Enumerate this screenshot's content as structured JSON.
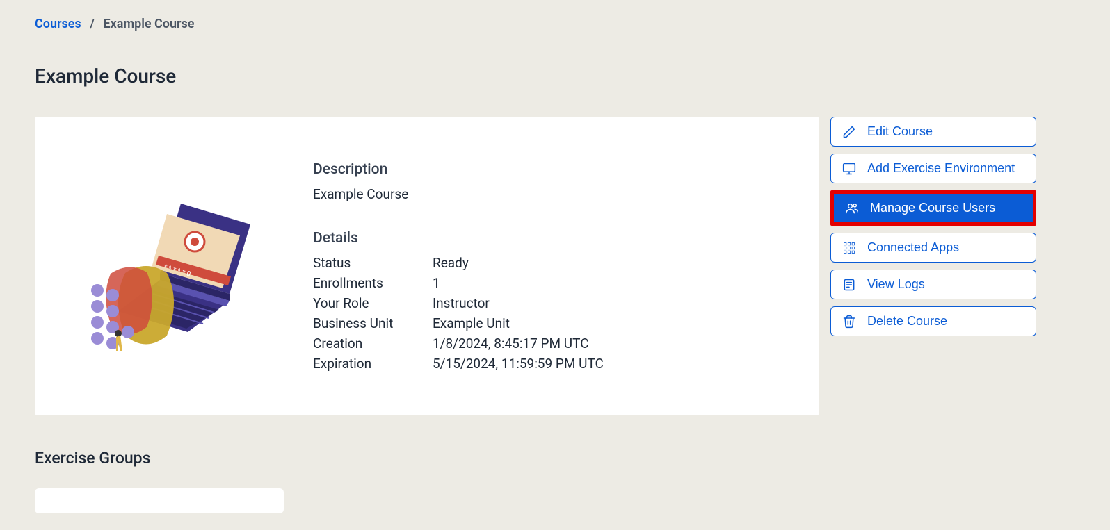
{
  "breadcrumb": {
    "root": "Courses",
    "sep": "/",
    "current": "Example Course"
  },
  "page_title": "Example Course",
  "description": {
    "heading": "Description",
    "text": "Example Course"
  },
  "details": {
    "heading": "Details",
    "rows": [
      {
        "label": "Status",
        "value": "Ready"
      },
      {
        "label": "Enrollments",
        "value": "1"
      },
      {
        "label": "Your Role",
        "value": "Instructor"
      },
      {
        "label": "Business Unit",
        "value": "Example Unit"
      },
      {
        "label": "Creation",
        "value": "1/8/2024, 8:45:17 PM UTC"
      },
      {
        "label": "Expiration",
        "value": "5/15/2024, 11:59:59 PM UTC"
      }
    ]
  },
  "actions": {
    "edit": "Edit Course",
    "add_env": "Add Exercise Environment",
    "manage_users": "Manage Course Users",
    "connected_apps": "Connected Apps",
    "view_logs": "View Logs",
    "delete": "Delete Course"
  },
  "exercise_groups_heading": "Exercise Groups"
}
